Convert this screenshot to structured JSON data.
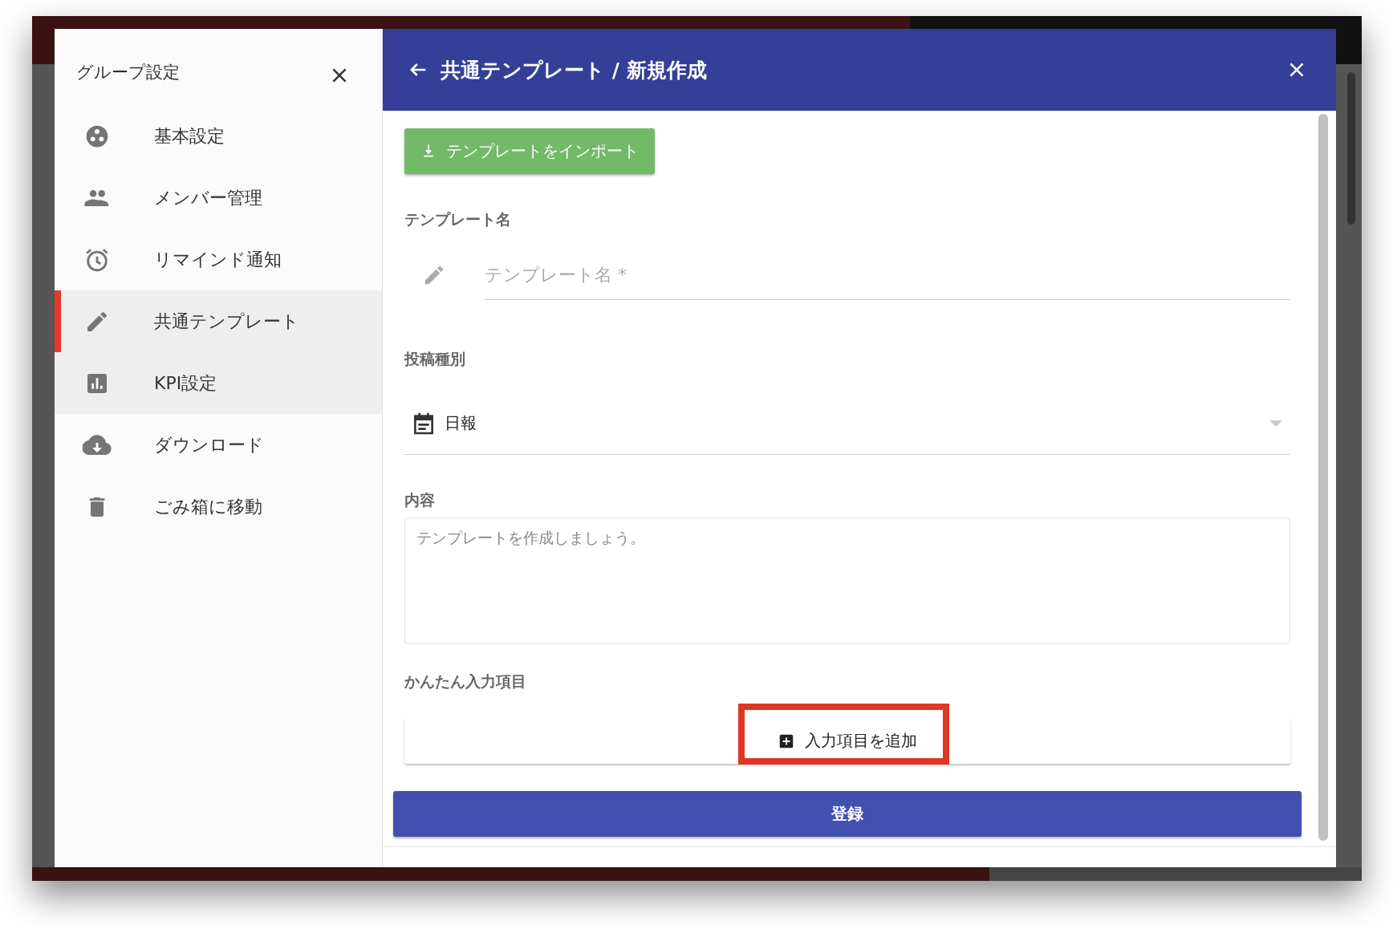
{
  "sidebar": {
    "title": "グループ設定",
    "items": [
      {
        "label": "基本設定",
        "selected": false,
        "hovered": false
      },
      {
        "label": "メンバー管理",
        "selected": false,
        "hovered": false
      },
      {
        "label": "リマインド通知",
        "selected": false,
        "hovered": false
      },
      {
        "label": "共通テンプレート",
        "selected": true,
        "hovered": false
      },
      {
        "label": "KPI設定",
        "selected": false,
        "hovered": true
      },
      {
        "label": "ダウンロード",
        "selected": false,
        "hovered": false
      },
      {
        "label": "ごみ箱に移動",
        "selected": false,
        "hovered": false
      }
    ]
  },
  "panel": {
    "title": "共通テンプレート / 新規作成",
    "import_button": "テンプレートをインポート",
    "fields": [
      {
        "kind": "text",
        "label": "テンプレート名",
        "placeholder": "テンプレート名 *"
      },
      {
        "kind": "select",
        "label": "投稿種別",
        "value": "日報"
      },
      {
        "kind": "textarea",
        "label": "内容",
        "placeholder": "テンプレートを作成しましょう。"
      },
      {
        "kind": "adder",
        "label": "かんたん入力項目",
        "button": "入力項目を追加",
        "highlighted": true
      }
    ],
    "submit_button": "登録"
  }
}
